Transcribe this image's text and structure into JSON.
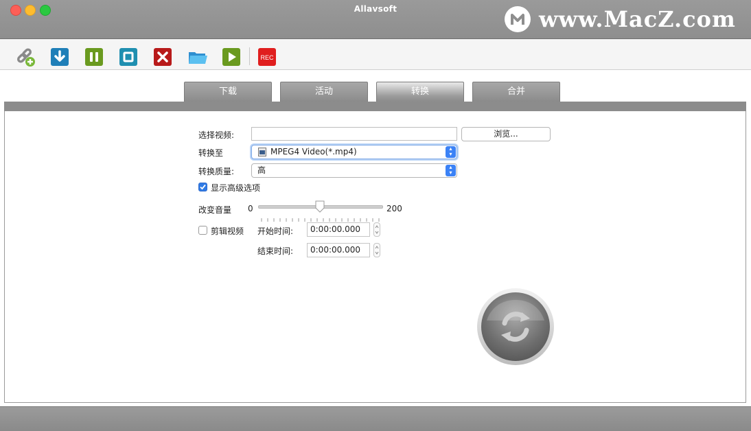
{
  "window": {
    "title": "Allavsoft"
  },
  "watermark": {
    "text": "www.MacZ.com",
    "logo_icon": "m-logo-icon"
  },
  "toolbar": {
    "buttons": [
      {
        "name": "add-link-button",
        "icon": "link-add-icon",
        "color": "#7aa83a"
      },
      {
        "name": "download-button",
        "icon": "download-icon",
        "color": "#1f7fb8"
      },
      {
        "name": "pause-button",
        "icon": "pause-icon",
        "color": "#6a9a1f"
      },
      {
        "name": "stop-button",
        "icon": "stop-icon",
        "color": "#1f8fb0"
      },
      {
        "name": "delete-button",
        "icon": "close-icon",
        "color": "#c81e1e"
      },
      {
        "name": "open-folder-button",
        "icon": "folder-icon",
        "color": "#3aa6e0"
      },
      {
        "name": "play-button",
        "icon": "play-icon",
        "color": "#6a9a1f"
      },
      {
        "name": "record-button",
        "icon": "rec-icon",
        "color": "#e01e1e",
        "label": "REC"
      }
    ]
  },
  "tabs": [
    {
      "label": "下载",
      "active": false
    },
    {
      "label": "活动",
      "active": false
    },
    {
      "label": "转换",
      "active": true
    },
    {
      "label": "合并",
      "active": false
    }
  ],
  "form": {
    "select_video_label": "选择视频:",
    "select_video_value": "",
    "browse_label": "浏览...",
    "convert_to_label": "转换至",
    "convert_to_value": "MPEG4 Video(*.mp4)",
    "quality_label": "转换质量:",
    "quality_value": "高",
    "advanced_label": "显示高级选项",
    "advanced_checked": true,
    "volume_label": "改变音量",
    "volume_min": "0",
    "volume_max": "200",
    "volume_value": 100,
    "trim_label": "剪辑视频",
    "trim_checked": false,
    "start_label": "开始时间:",
    "start_value": "0:00:00.000",
    "end_label": "结束时间:",
    "end_value": "0:00:00.000"
  },
  "convert_button": {
    "icon": "refresh-icon"
  }
}
